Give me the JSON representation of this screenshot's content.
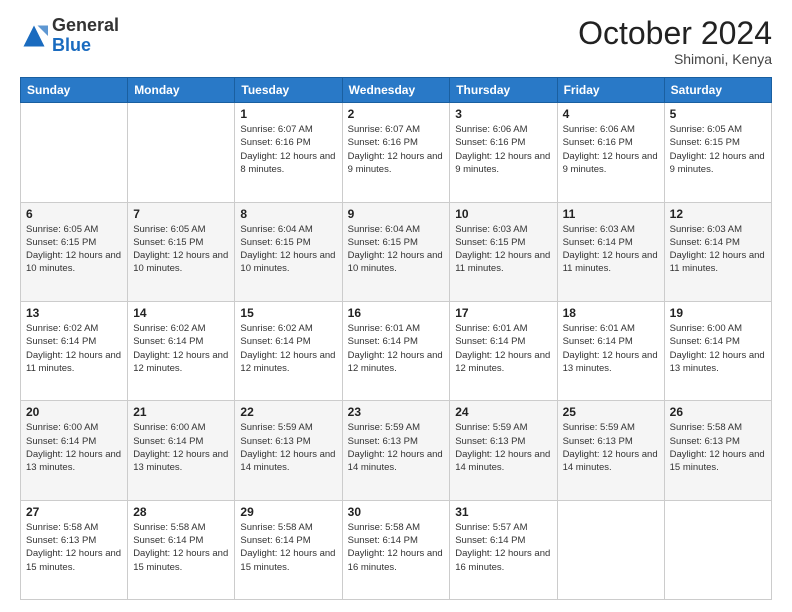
{
  "header": {
    "logo": {
      "general": "General",
      "blue": "Blue"
    },
    "title": "October 2024",
    "location": "Shimoni, Kenya"
  },
  "days_of_week": [
    "Sunday",
    "Monday",
    "Tuesday",
    "Wednesday",
    "Thursday",
    "Friday",
    "Saturday"
  ],
  "weeks": [
    [
      {
        "day": "",
        "info": ""
      },
      {
        "day": "",
        "info": ""
      },
      {
        "day": "1",
        "info": "Sunrise: 6:07 AM\nSunset: 6:16 PM\nDaylight: 12 hours and 8 minutes."
      },
      {
        "day": "2",
        "info": "Sunrise: 6:07 AM\nSunset: 6:16 PM\nDaylight: 12 hours and 9 minutes."
      },
      {
        "day": "3",
        "info": "Sunrise: 6:06 AM\nSunset: 6:16 PM\nDaylight: 12 hours and 9 minutes."
      },
      {
        "day": "4",
        "info": "Sunrise: 6:06 AM\nSunset: 6:16 PM\nDaylight: 12 hours and 9 minutes."
      },
      {
        "day": "5",
        "info": "Sunrise: 6:05 AM\nSunset: 6:15 PM\nDaylight: 12 hours and 9 minutes."
      }
    ],
    [
      {
        "day": "6",
        "info": "Sunrise: 6:05 AM\nSunset: 6:15 PM\nDaylight: 12 hours and 10 minutes."
      },
      {
        "day": "7",
        "info": "Sunrise: 6:05 AM\nSunset: 6:15 PM\nDaylight: 12 hours and 10 minutes."
      },
      {
        "day": "8",
        "info": "Sunrise: 6:04 AM\nSunset: 6:15 PM\nDaylight: 12 hours and 10 minutes."
      },
      {
        "day": "9",
        "info": "Sunrise: 6:04 AM\nSunset: 6:15 PM\nDaylight: 12 hours and 10 minutes."
      },
      {
        "day": "10",
        "info": "Sunrise: 6:03 AM\nSunset: 6:15 PM\nDaylight: 12 hours and 11 minutes."
      },
      {
        "day": "11",
        "info": "Sunrise: 6:03 AM\nSunset: 6:14 PM\nDaylight: 12 hours and 11 minutes."
      },
      {
        "day": "12",
        "info": "Sunrise: 6:03 AM\nSunset: 6:14 PM\nDaylight: 12 hours and 11 minutes."
      }
    ],
    [
      {
        "day": "13",
        "info": "Sunrise: 6:02 AM\nSunset: 6:14 PM\nDaylight: 12 hours and 11 minutes."
      },
      {
        "day": "14",
        "info": "Sunrise: 6:02 AM\nSunset: 6:14 PM\nDaylight: 12 hours and 12 minutes."
      },
      {
        "day": "15",
        "info": "Sunrise: 6:02 AM\nSunset: 6:14 PM\nDaylight: 12 hours and 12 minutes."
      },
      {
        "day": "16",
        "info": "Sunrise: 6:01 AM\nSunset: 6:14 PM\nDaylight: 12 hours and 12 minutes."
      },
      {
        "day": "17",
        "info": "Sunrise: 6:01 AM\nSunset: 6:14 PM\nDaylight: 12 hours and 12 minutes."
      },
      {
        "day": "18",
        "info": "Sunrise: 6:01 AM\nSunset: 6:14 PM\nDaylight: 12 hours and 13 minutes."
      },
      {
        "day": "19",
        "info": "Sunrise: 6:00 AM\nSunset: 6:14 PM\nDaylight: 12 hours and 13 minutes."
      }
    ],
    [
      {
        "day": "20",
        "info": "Sunrise: 6:00 AM\nSunset: 6:14 PM\nDaylight: 12 hours and 13 minutes."
      },
      {
        "day": "21",
        "info": "Sunrise: 6:00 AM\nSunset: 6:14 PM\nDaylight: 12 hours and 13 minutes."
      },
      {
        "day": "22",
        "info": "Sunrise: 5:59 AM\nSunset: 6:13 PM\nDaylight: 12 hours and 14 minutes."
      },
      {
        "day": "23",
        "info": "Sunrise: 5:59 AM\nSunset: 6:13 PM\nDaylight: 12 hours and 14 minutes."
      },
      {
        "day": "24",
        "info": "Sunrise: 5:59 AM\nSunset: 6:13 PM\nDaylight: 12 hours and 14 minutes."
      },
      {
        "day": "25",
        "info": "Sunrise: 5:59 AM\nSunset: 6:13 PM\nDaylight: 12 hours and 14 minutes."
      },
      {
        "day": "26",
        "info": "Sunrise: 5:58 AM\nSunset: 6:13 PM\nDaylight: 12 hours and 15 minutes."
      }
    ],
    [
      {
        "day": "27",
        "info": "Sunrise: 5:58 AM\nSunset: 6:13 PM\nDaylight: 12 hours and 15 minutes."
      },
      {
        "day": "28",
        "info": "Sunrise: 5:58 AM\nSunset: 6:14 PM\nDaylight: 12 hours and 15 minutes."
      },
      {
        "day": "29",
        "info": "Sunrise: 5:58 AM\nSunset: 6:14 PM\nDaylight: 12 hours and 15 minutes."
      },
      {
        "day": "30",
        "info": "Sunrise: 5:58 AM\nSunset: 6:14 PM\nDaylight: 12 hours and 16 minutes."
      },
      {
        "day": "31",
        "info": "Sunrise: 5:57 AM\nSunset: 6:14 PM\nDaylight: 12 hours and 16 minutes."
      },
      {
        "day": "",
        "info": ""
      },
      {
        "day": "",
        "info": ""
      }
    ]
  ]
}
